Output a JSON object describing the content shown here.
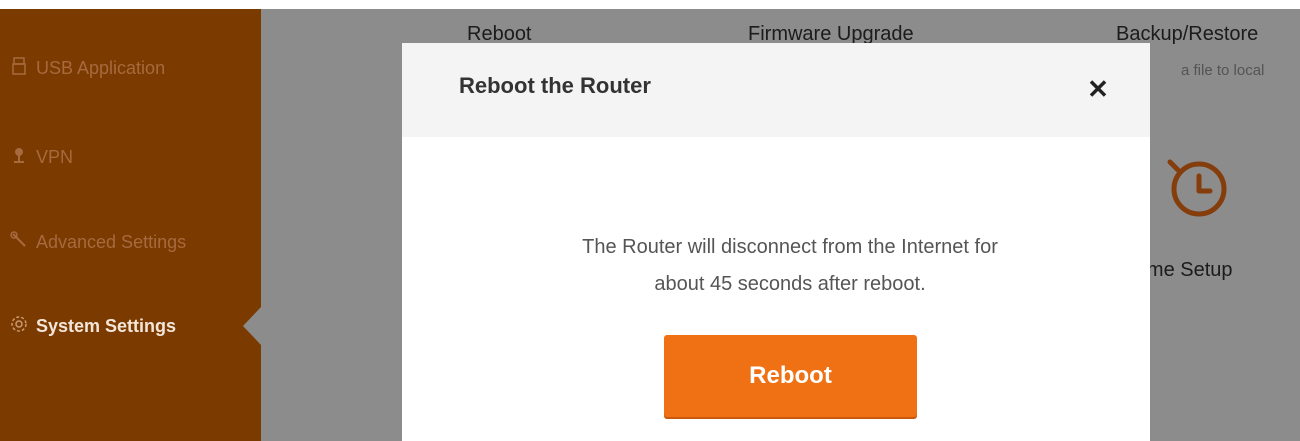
{
  "sidebar": {
    "items": [
      {
        "label": "USB Application",
        "icon": "usb-icon"
      },
      {
        "label": "VPN",
        "icon": "vpn-icon"
      },
      {
        "label": "Advanced Settings",
        "icon": "wrench-icon"
      },
      {
        "label": "System Settings",
        "icon": "gear-icon",
        "active": true
      }
    ]
  },
  "tools": {
    "reboot": "Reboot",
    "firmware": "Firmware Upgrade",
    "backup": "Backup/Restore",
    "backup_sub": "a file to local",
    "time_setup": "Time Setup"
  },
  "modal": {
    "title": "Reboot the Router",
    "close_glyph": "✕",
    "message_line1": "The Router will disconnect from the Internet for",
    "message_line2": "about 45 seconds after reboot.",
    "button_label": "Reboot"
  },
  "colors": {
    "sidebar_bg": "#7b3a00",
    "accent": "#f07014"
  }
}
